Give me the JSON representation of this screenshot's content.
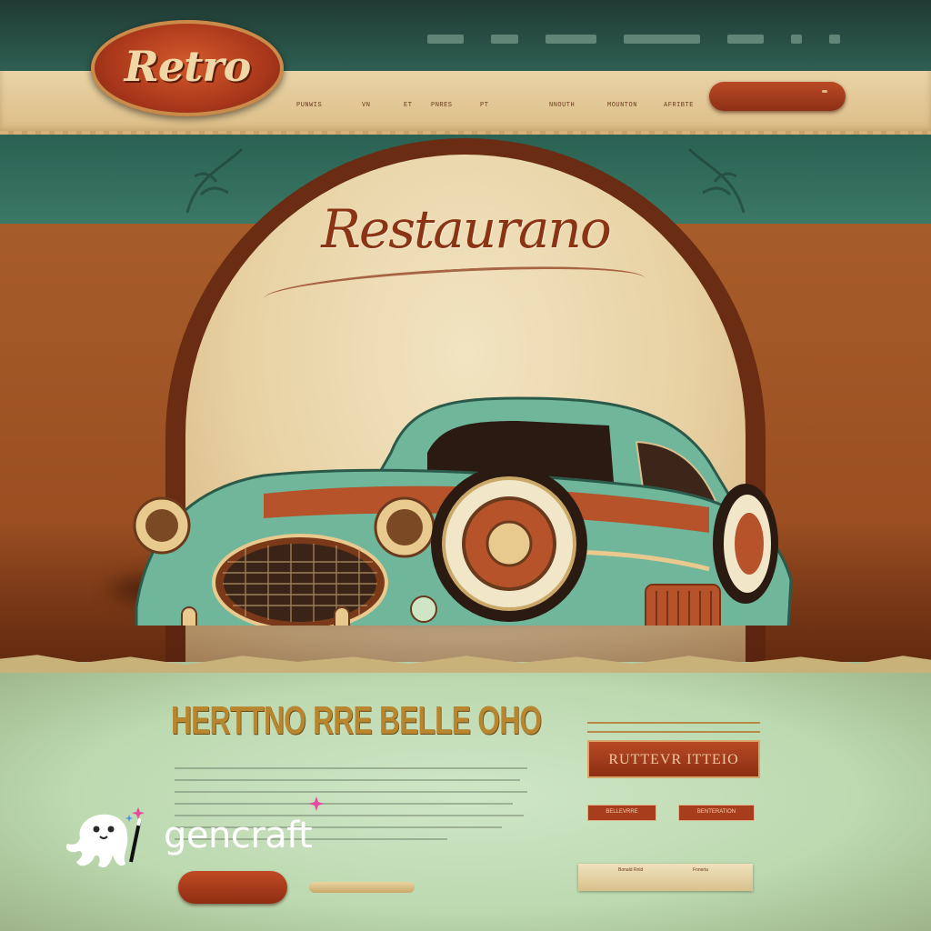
{
  "brand": {
    "logo_text": "Retro",
    "hero_script": "Restaurano"
  },
  "top_nav": {
    "items": [
      "",
      "",
      "",
      "",
      "",
      "",
      ""
    ]
  },
  "main_nav": {
    "items": [
      "PUNWIS",
      "VN",
      "ET",
      "PNRES",
      "PT",
      "NNOUTH",
      "MOUNTON",
      "AFRIBTE"
    ]
  },
  "hero": {
    "car_colors": {
      "body": "#6fb69b",
      "accent": "#b6532a",
      "chrome": "#e8c98e"
    }
  },
  "content": {
    "headline": "HERTTNO RRE BELLE OHO",
    "primary_button_label": "",
    "badge_label": "RUTTEVR ITTEIO",
    "chips": [
      "BELLEVRRE",
      "BENTERATION"
    ],
    "card": {
      "left": "Bonald Rnld",
      "right": "Fnneria"
    }
  },
  "watermark": {
    "text": "gencraft"
  },
  "colors": {
    "teal": "#2f6a5a",
    "cream": "#e9d3a6",
    "rust": "#a8361a",
    "mint": "#cfe6c6",
    "gold": "#b8862e"
  }
}
